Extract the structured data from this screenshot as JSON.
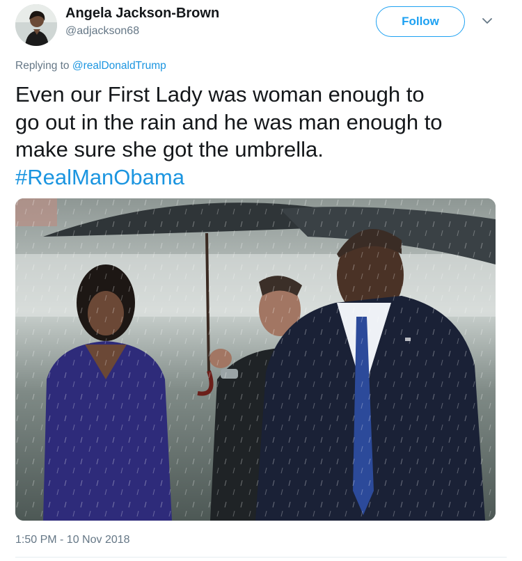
{
  "user": {
    "name": "Angela Jackson-Brown",
    "handle": "@adjackson68"
  },
  "follow_button": {
    "label": "Follow"
  },
  "reply": {
    "prefix": "Replying to ",
    "mention": "@realDonaldTrump"
  },
  "tweet": {
    "lines": [
      "Even our First Lady was woman enough to",
      "go out in the rain and he was man enough to",
      "make sure she got the umbrella."
    ],
    "hashtag": "#RealManObama"
  },
  "timestamp": "1:50 PM - 10 Nov 2018",
  "colors": {
    "accent": "#1da1f2",
    "link": "#1b95e0",
    "secondary_text": "#657786",
    "primary_text": "#14171a"
  },
  "icons": {
    "caret": "chevron-down-icon"
  }
}
